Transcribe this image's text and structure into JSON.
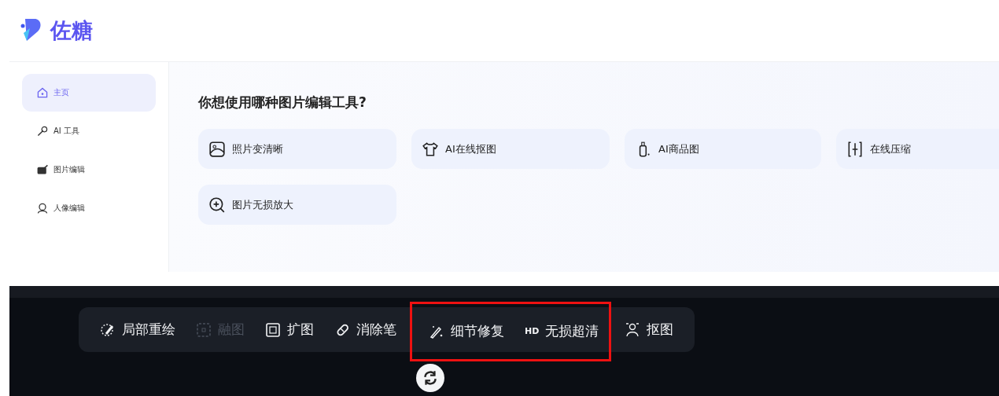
{
  "app": {
    "name": "佐糖"
  },
  "sidebar": {
    "items": [
      {
        "label": "主页",
        "selected": true
      },
      {
        "label": "AI 工具",
        "selected": false
      },
      {
        "label": "图片编辑",
        "selected": false
      },
      {
        "label": "人像编辑",
        "selected": false
      }
    ]
  },
  "main": {
    "heading": "你想使用哪种图片编辑工具?",
    "tools": [
      {
        "label": "照片变清晰"
      },
      {
        "label": "AI在线抠图"
      },
      {
        "label": "AI商品图"
      },
      {
        "label": "在线压缩"
      },
      {
        "label": "图片无损放大"
      }
    ]
  },
  "toolbar": {
    "items": [
      {
        "label": "局部重绘",
        "disabled": false,
        "highlighted": false
      },
      {
        "label": "融图",
        "disabled": true,
        "highlighted": false
      },
      {
        "label": "扩图",
        "disabled": false,
        "highlighted": false
      },
      {
        "label": "消除笔",
        "disabled": false,
        "highlighted": false
      },
      {
        "label": "细节修复",
        "disabled": false,
        "highlighted": true
      },
      {
        "label": "无损超清",
        "icon_text": "HD",
        "disabled": false,
        "highlighted": true
      },
      {
        "label": "抠图",
        "disabled": false,
        "highlighted": false
      }
    ]
  }
}
